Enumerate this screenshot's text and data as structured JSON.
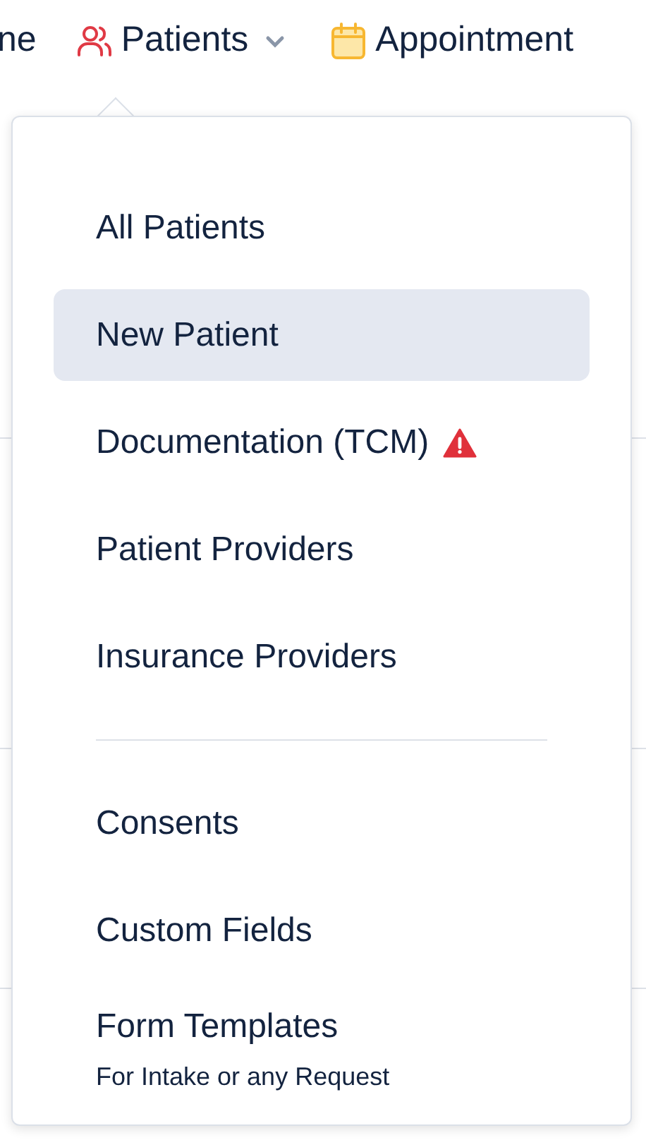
{
  "nav": [
    {
      "label": "ne",
      "kind": "plain",
      "dropdown": false
    },
    {
      "label": "Patients",
      "kind": "users",
      "dropdown": true
    },
    {
      "label": "Appointment",
      "kind": "calendar",
      "dropdown": false
    }
  ],
  "menu": [
    {
      "kind": "item",
      "label": "All Patients",
      "selected": false,
      "warning": false
    },
    {
      "kind": "item",
      "label": "New Patient",
      "selected": true,
      "warning": false
    },
    {
      "kind": "item",
      "label": "Documentation (TCM)",
      "selected": false,
      "warning": true
    },
    {
      "kind": "item",
      "label": "Patient Providers",
      "selected": false,
      "warning": false
    },
    {
      "kind": "item",
      "label": "Insurance Providers",
      "selected": false,
      "warning": false
    },
    {
      "kind": "divider"
    },
    {
      "kind": "item",
      "label": "Consents",
      "selected": false,
      "warning": false
    },
    {
      "kind": "item",
      "label": "Custom Fields",
      "selected": false,
      "warning": false
    },
    {
      "kind": "item",
      "label": "Form Templates",
      "subtitle": "For Intake or any Request",
      "selected": false,
      "warning": false
    }
  ]
}
